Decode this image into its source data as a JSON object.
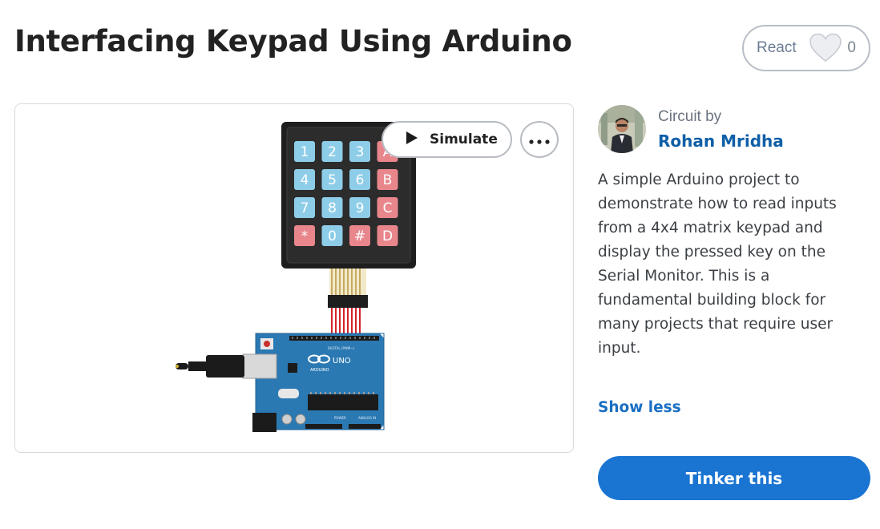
{
  "page": {
    "title": "Interfacing Keypad Using Arduino"
  },
  "react": {
    "label": "React",
    "count": "0",
    "icon": "heart-icon"
  },
  "preview": {
    "simulate_label": "Simulate",
    "more_icon": "more-horizontal-icon",
    "keypad_keys": [
      "1",
      "2",
      "3",
      "A",
      "4",
      "5",
      "6",
      "B",
      "7",
      "8",
      "9",
      "C",
      "*",
      "0",
      "#",
      "D"
    ],
    "board_label": "UNO"
  },
  "author": {
    "circuit_by": "Circuit by",
    "name": "Rohan Mridha"
  },
  "description": "A simple Arduino project to demonstrate how to read inputs from a 4x4 matrix keypad and display the pressed key on the Serial Monitor. This is a fundamental building block for many projects that require user input.",
  "actions": {
    "show_less": "Show less",
    "tinker": "Tinker this"
  },
  "colors": {
    "accent": "#1a74d2",
    "author_link": "#0f5fa8",
    "keypad_blue": "#8ecde8",
    "keypad_red": "#e8868c"
  }
}
